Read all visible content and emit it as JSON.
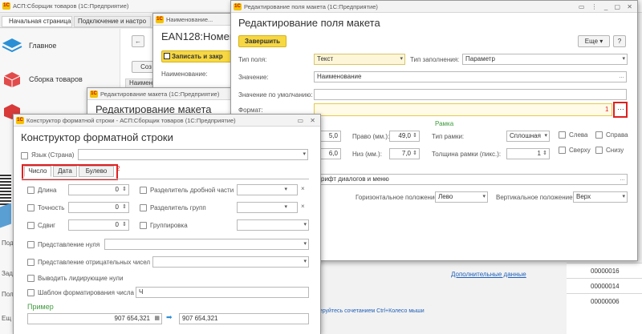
{
  "main": {
    "title": "АСП:Сборщик товаров (1С:Предприятие)",
    "tabs": [
      "Начальная страница",
      "Подключение и настро"
    ],
    "sidebar": [
      {
        "label": "Главное",
        "icon": "stack-icon"
      },
      {
        "label": "Сборка товаров",
        "icon": "box-icon"
      },
      {
        "label": "",
        "icon": "cube-icon"
      }
    ],
    "left_labels": [
      "Под",
      "Зад",
      "Пол",
      "Ещ"
    ],
    "left_labels2": [
      "Ра",
      "Ра",
      "Ра",
      "Ра",
      "Ра"
    ],
    "codes": [
      "00000016",
      "00000014",
      "00000006"
    ],
    "more_data_link": "Дополнительные данные",
    "hint": "...еруйтесь сочетанием Ctrl+Колесо мыши",
    "create_btn": "Соз",
    "name_col": "Наимен"
  },
  "ean_window": {
    "titlebar": "Наименование...",
    "title": "EAN128:Номен",
    "write_close": "Записать и закр",
    "name_label": "Наименование:"
  },
  "layout_window": {
    "titlebar": "Редактирование макета (1С:Предприятие)",
    "title": "Редактирование макета"
  },
  "field_window": {
    "titlebar": "Редактирование поля макета (1С:Предприятие)",
    "title": "Редактирование поля макета",
    "finish": "Завершить",
    "more": "Еще",
    "help": "?",
    "field_type_label": "Тип поля:",
    "field_type_value": "Текст",
    "fill_type_label": "Тип заполнения:",
    "fill_type_value": "Параметр",
    "value_label": "Значение:",
    "value_value": "Наименование",
    "default_label": "Значение по умолчанию:",
    "format_label": "Формат:",
    "frame_title": "Рамка",
    "right_label": "Право (мм.):",
    "right_value": "49,0",
    "bottom_label": "Низ (мм.):",
    "bottom_value": "7,0",
    "left_val": "5,0",
    "left_val2": "6,0",
    "frame_type_label": "Тип рамки:",
    "frame_type_value": "Сплошная",
    "frame_thickness_label": "Толщина рамки (пикс.):",
    "frame_thickness_value": "1",
    "sides": [
      "Слева",
      "Справа",
      "Сверху",
      "Снизу"
    ],
    "font_value": "рифт диалогов и меню",
    "horiz_label": "Горизонтальное положение:",
    "horiz_value": "Лево",
    "vert_label": "Вертикальное положение:",
    "vert_value": "Верх",
    "marker1": "1"
  },
  "format_window": {
    "titlebar": "Конструктор форматной строки - АСП:Сборщик товаров (1С:Предприятие)",
    "title": "Конструктор форматной строки",
    "lang_label": "Язык (Страна)",
    "tabs": [
      "Число",
      "Дата",
      "Булево"
    ],
    "marker2": "2",
    "length_label": "Длина",
    "length_value": "0",
    "precision_label": "Точность",
    "precision_value": "0",
    "shift_label": "Сдвиг",
    "shift_value": "0",
    "decimal_sep_label": "Разделитель дробной части",
    "group_sep_label": "Разделитель групп",
    "grouping_label": "Группировка",
    "zero_repr_label": "Представление нуля",
    "neg_repr_label": "Представление отрицательных чисел",
    "leading_zeros_label": "Выводить лидирующие нули",
    "template_label": "Шаблон форматирования числа",
    "template_value": "Ч",
    "example_label": "Пример",
    "example_in": "907 654,321",
    "example_out": "907 654,321"
  },
  "colors": {
    "accent_yellow": "#f7d842",
    "marker_red": "#e02020",
    "link_blue": "#1f5fb8",
    "green_label": "#3d9a3d"
  }
}
